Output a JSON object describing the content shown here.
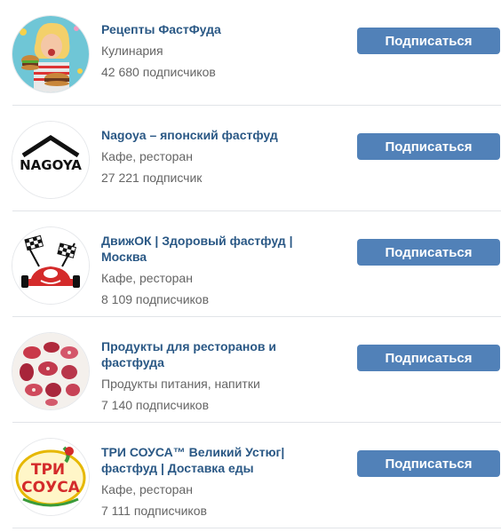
{
  "communities": [
    {
      "name": "Рецепты ФастФуда",
      "category": "Кулинария",
      "subscribers": "42 680 подписчиков",
      "button": "Подписаться",
      "avatar_icon": "woman-with-burgers-photo"
    },
    {
      "name": "Nagoya – японский фастфуд",
      "category": "Кафе, ресторан",
      "subscribers": "27 221 подписчик",
      "button": "Подписаться",
      "avatar_icon": "nagoya-logo",
      "logo_text": "NAGOYA"
    },
    {
      "name": "ДвижОК | Здоровый фастфуд | Москва",
      "category": "Кафе, ресторан",
      "subscribers": "8 109 подписчиков",
      "button": "Подписаться",
      "avatar_icon": "race-car-checkered-flags-logo"
    },
    {
      "name": "Продукты для ресторанов и фастфуда",
      "category": "Продукты питания, напитки",
      "subscribers": "7 140 подписчиков",
      "button": "Подписаться",
      "avatar_icon": "meat-cuts-illustration"
    },
    {
      "name": "ТРИ СОУСА™ Великий Устюг| фастфуд | Доставка еды",
      "category": "Кафе, ресторан",
      "subscribers": "7 111 подписчиков",
      "button": "Подписаться",
      "avatar_icon": "tri-sousa-logo",
      "logo_text_1": "ТРИ",
      "logo_text_2": "СОУСА"
    }
  ],
  "colors": {
    "link": "#2a5885",
    "button": "#5181b8",
    "meta": "#656565",
    "divider": "#e1e4e8"
  }
}
